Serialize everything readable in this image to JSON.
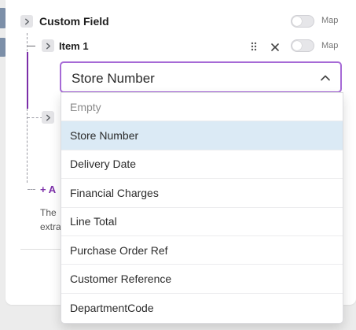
{
  "colors": {
    "accent": "#a66ad6",
    "tree_line": "#7b2ea8",
    "selected_option_bg": "#dbeaf5",
    "side_tab": "#7c8fa8"
  },
  "custom_field": {
    "label": "Custom Field",
    "map_label": "Map",
    "map_toggle_on": false
  },
  "item": {
    "label": "Item 1",
    "map_label": "Map",
    "map_toggle_on": false,
    "drag_icon": "drag-handle-icon",
    "remove_icon": "close-icon"
  },
  "select": {
    "value": "Store Number",
    "expanded": true
  },
  "dropdown": {
    "options": [
      {
        "label": "Empty"
      },
      {
        "label": "Store Number"
      },
      {
        "label": "Delivery Date"
      },
      {
        "label": "Financial Charges"
      },
      {
        "label": "Line Total"
      },
      {
        "label": "Purchase Order Ref"
      },
      {
        "label": "Customer Reference"
      },
      {
        "label": "DepartmentCode"
      }
    ],
    "selected_index": 1
  },
  "background": {
    "add_link_visible_text": "+ A",
    "help_text_line1": "The",
    "help_text_line2": "extra"
  }
}
